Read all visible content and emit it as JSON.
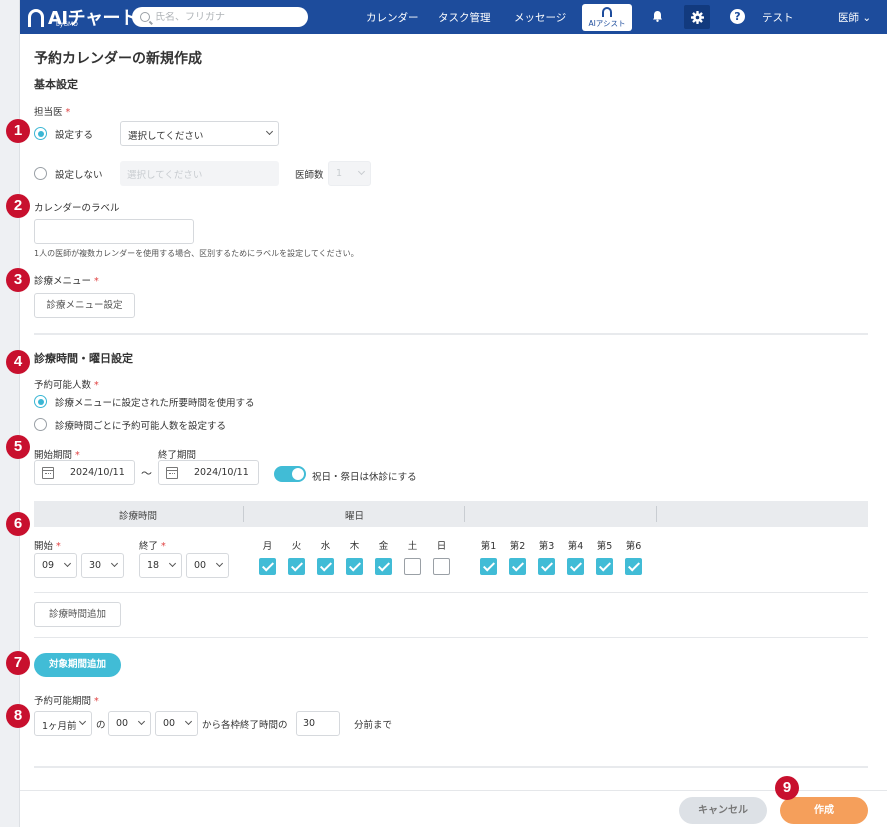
{
  "header": {
    "logo_text": "AIチャート",
    "logo_sub": "byGMO",
    "search_placeholder": "氏名、フリガナ",
    "nav": [
      "カレンダー",
      "タスク管理",
      "メッセージ"
    ],
    "assist_label": "AIアシスト",
    "help_glyph": "?",
    "user_name": "テスト",
    "user_role": "医師",
    "user_role_chevron": "⌄"
  },
  "page": {
    "title": "予約カレンダーの新規作成",
    "basic_heading": "基本設定",
    "doctor_label": "担当医",
    "required_mark": "*",
    "radio_assign": "設定する",
    "radio_no_assign": "設定しない",
    "select_placeholder": "選択してください",
    "doctor_count_label": "医師数",
    "doctor_count_value": "1",
    "calendar_label_title": "カレンダーのラベル",
    "calendar_label_hint": "1人の医師が複数カレンダーを使用する場合、区別するためにラベルを設定してください。",
    "menu_label": "診療メニュー",
    "menu_button": "診療メニュー設定",
    "time_heading": "診療時間・曜日設定",
    "capacity_label": "予約可能人数",
    "capacity_opt1": "診療メニューに設定された所要時間を使用する",
    "capacity_opt2": "診療時間ごとに予約可能人数を設定する",
    "start_period_label": "開始期間",
    "end_period_label": "終了期間",
    "start_date": "2024/10/11",
    "end_date": "2024/10/11",
    "tilde": "〜",
    "holiday_toggle_label": "祝日・祭日は休診にする",
    "table_header_time": "診療時間",
    "table_header_day": "曜日",
    "start_label": "開始",
    "end_label": "終了",
    "start_hour": "09",
    "start_min": "30",
    "end_hour": "18",
    "end_min": "00",
    "weekdays": [
      {
        "label": "月",
        "checked": true
      },
      {
        "label": "火",
        "checked": true
      },
      {
        "label": "水",
        "checked": true
      },
      {
        "label": "木",
        "checked": true
      },
      {
        "label": "金",
        "checked": true
      },
      {
        "label": "土",
        "checked": false
      },
      {
        "label": "日",
        "checked": false
      }
    ],
    "weeks": [
      {
        "label": "第1",
        "checked": true
      },
      {
        "label": "第2",
        "checked": true
      },
      {
        "label": "第3",
        "checked": true
      },
      {
        "label": "第4",
        "checked": true
      },
      {
        "label": "第5",
        "checked": true
      },
      {
        "label": "第6",
        "checked": true
      }
    ],
    "add_time_button": "診療時間追加",
    "add_period_button": "対象期間追加",
    "booking_period_label": "予約可能期間",
    "booking_months": "1ヶ月前",
    "booking_of": "の",
    "booking_hour": "00",
    "booking_min": "00",
    "booking_from_text": "から各枠終了時間の",
    "booking_minutes": "30",
    "booking_minutes_suffix": "分前まで"
  },
  "footer": {
    "cancel": "キャンセル",
    "create": "作成"
  },
  "markers": [
    "1",
    "2",
    "3",
    "4",
    "5",
    "6",
    "7",
    "8",
    "9"
  ],
  "colors": {
    "header_bg": "#1d4c9c",
    "accent_teal": "#41bcd6",
    "create_orange": "#f59f5b",
    "marker_red": "#c8102e"
  }
}
